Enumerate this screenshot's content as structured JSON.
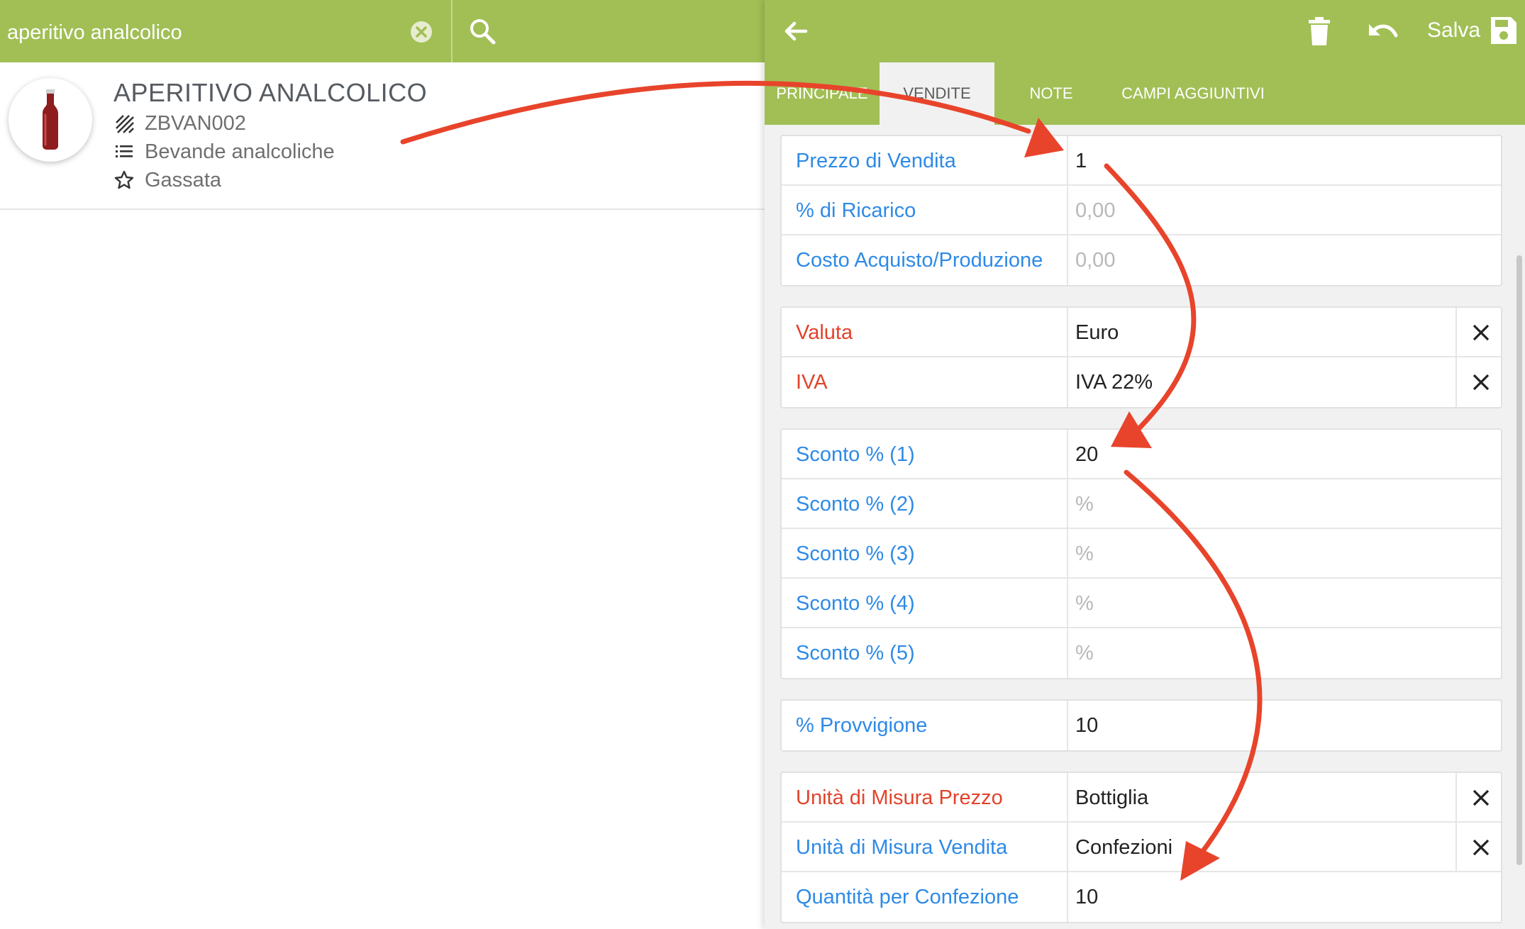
{
  "search": {
    "value": "aperitivo analcolico",
    "clear_icon": "clear-circle-icon",
    "search_icon": "search-icon"
  },
  "product": {
    "title": "APERITIVO ANALCOLICO",
    "code": "ZBVAN002",
    "category": "Bevande analcoliche",
    "attribute": "Gassata",
    "image_icon": "bottle-icon"
  },
  "toolbar": {
    "back_icon": "arrow-left-icon",
    "delete_icon": "trash-icon",
    "undo_icon": "undo-icon",
    "save_label": "Salva",
    "save_icon": "floppy-disk-icon"
  },
  "tabs": [
    {
      "label": "PRINCIPALE",
      "active": false
    },
    {
      "label": "VENDITE",
      "active": true
    },
    {
      "label": "NOTE",
      "active": false
    },
    {
      "label": "CAMPI AGGIUNTIVI",
      "active": false
    }
  ],
  "groups": {
    "prices": [
      {
        "label": "Prezzo di Vendita",
        "value": "1",
        "placeholder": ""
      },
      {
        "label": "% di Ricarico",
        "value": "",
        "placeholder": "0,00"
      },
      {
        "label": "Costo Acquisto/Produzione",
        "value": "",
        "placeholder": "0,00"
      }
    ],
    "tax": [
      {
        "label": "Valuta",
        "value": "Euro"
      },
      {
        "label": "IVA",
        "value": "IVA 22%"
      }
    ],
    "discounts": [
      {
        "label": "Sconto % (1)",
        "value": "20",
        "placeholder": "%"
      },
      {
        "label": "Sconto % (2)",
        "value": "",
        "placeholder": "%"
      },
      {
        "label": "Sconto % (3)",
        "value": "",
        "placeholder": "%"
      },
      {
        "label": "Sconto % (4)",
        "value": "",
        "placeholder": "%"
      },
      {
        "label": "Sconto % (5)",
        "value": "",
        "placeholder": "%"
      }
    ],
    "commission": [
      {
        "label": "% Provvigione",
        "value": "10"
      }
    ],
    "units": [
      {
        "label": "Unità di Misura Prezzo",
        "value": "Bottiglia"
      },
      {
        "label": "Unità di Misura Vendita",
        "value": "Confezioni"
      },
      {
        "label": "Quantità per Confezione",
        "value": "10"
      }
    ]
  },
  "colors": {
    "brand_green": "#a1bf55",
    "label_blue": "#2e8ae6",
    "required_red": "#e2432a",
    "arrow_red": "#e8442b"
  }
}
